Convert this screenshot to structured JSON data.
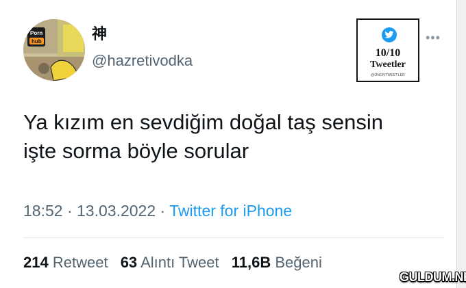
{
  "tweet": {
    "display_name": "神",
    "handle": "@hazretivodka",
    "text_line1": "Ya kızım en sevdiğim doğal taş sensin",
    "text_line2": "işte sorma böyle sorular",
    "time": "18:52",
    "date": "13.03.2022",
    "source": "Twitter for iPhone",
    "separator": " · ",
    "more_icon": "more-horizontal-icon"
  },
  "stats": {
    "retweets": "214",
    "retweets_label": "Retweet",
    "quotes": "63",
    "quotes_label": "Alıntı Tweet",
    "likes": "11,6B",
    "likes_label": "Beğeni"
  },
  "badge": {
    "icon": "twitter-bird-icon",
    "score": "10/10",
    "label": "Tweetler",
    "account": "@ONONTWEETLER"
  },
  "watermark": "GULDUM.NET",
  "colors": {
    "text": "#0f1419",
    "secondary": "#536471",
    "link": "#1d9bf0",
    "divider": "#e6e9ea"
  }
}
